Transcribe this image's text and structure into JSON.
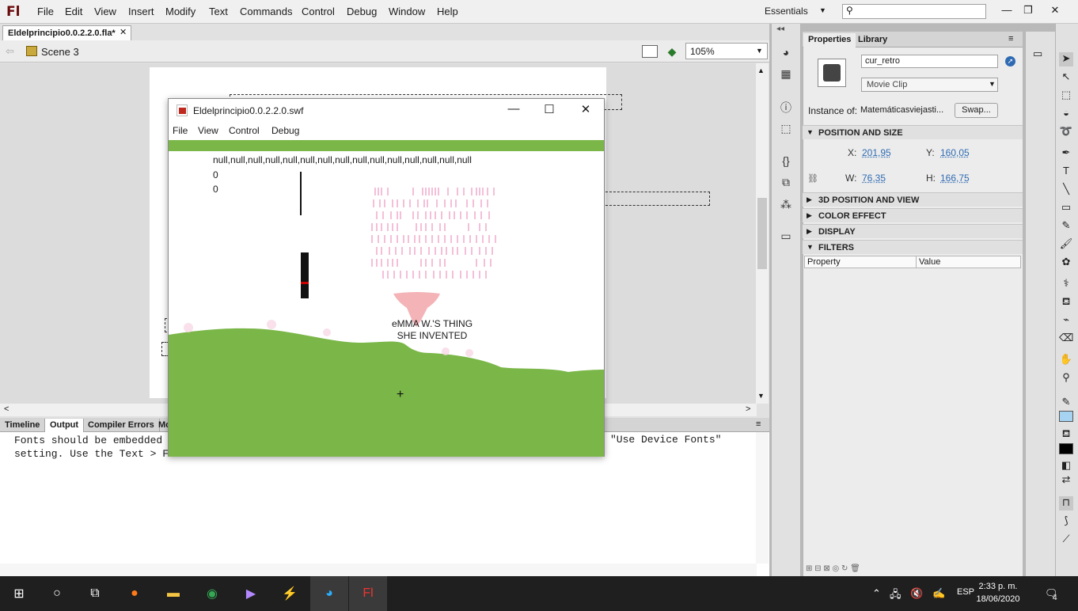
{
  "app": {
    "logo": "Fl"
  },
  "menu": [
    "File",
    "Edit",
    "View",
    "Insert",
    "Modify",
    "Text",
    "Commands",
    "Control",
    "Debug",
    "Window",
    "Help"
  ],
  "workspace": "Essentials",
  "document": {
    "tab": "Eldelprincipio0.0.2.2.0.fla*",
    "scene": "Scene 3",
    "zoom": "105%"
  },
  "output_tabs": [
    "Timeline",
    "Output",
    "Compiler Errors",
    "Mo"
  ],
  "output": {
    "line1": "Fonts should be embedded",
    "line2": "setting. Use the Text > F",
    "line1b": "\"Use Device Fonts\""
  },
  "swf_window": {
    "title": "Eldelprincipio0.0.2.2.0.swf",
    "menu": [
      "File",
      "View",
      "Control",
      "Debug"
    ],
    "nulls": "null,null,null,null,null,null,null,null,null,null,null,null,null,null,null",
    "zero1": "0",
    "zero2": "0",
    "thing_line1": "eMMA W.'S THING",
    "thing_line2": "SHE INVENTED"
  },
  "properties": {
    "tabs": [
      "Properties",
      "Library"
    ],
    "instance_name": "cur_retro",
    "symbol_type": "Movie Clip",
    "instance_of_label": "Instance of:",
    "instance_of_value": "Matemáticasviejasti...",
    "swap_label": "Swap...",
    "sections": [
      "POSITION AND SIZE",
      "3D POSITION AND VIEW",
      "COLOR EFFECT",
      "DISPLAY",
      "FILTERS"
    ],
    "x_label": "X:",
    "x": "201,95",
    "y_label": "Y:",
    "y": "160,05",
    "w_label": "W:",
    "w": "76,35",
    "h_label": "H:",
    "h": "166,75",
    "filter_cols": [
      "Property",
      "Value"
    ]
  },
  "taskbar": {
    "lang": "ESP",
    "time": "2:33 p. m.",
    "date": "18/06/2020",
    "notifications": "4"
  }
}
